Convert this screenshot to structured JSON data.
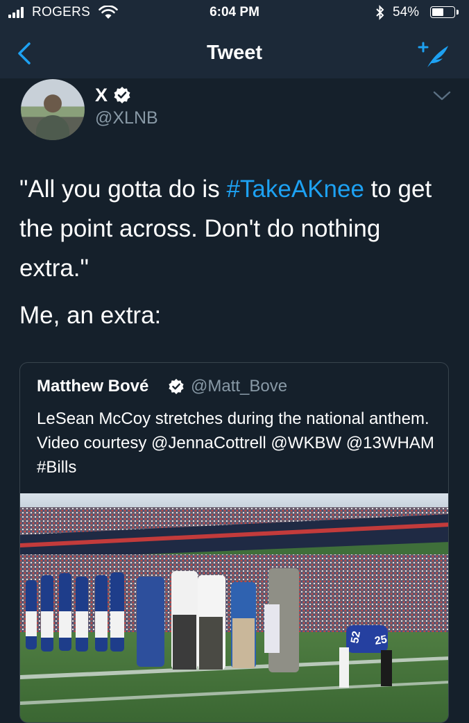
{
  "status_bar": {
    "carrier": "ROGERS",
    "time": "6:04 PM",
    "battery_percent": "54%",
    "battery_level": 0.54,
    "icons": [
      "signal-icon",
      "wifi-icon",
      "bluetooth-icon",
      "battery-icon"
    ]
  },
  "nav": {
    "title": "Tweet",
    "back_icon": "chevron-left-icon",
    "compose_icon": "compose-tweet-icon"
  },
  "tweet": {
    "author_name": "X",
    "author_handle": "@XLNB",
    "text_part1": "\"All you gotta do is ",
    "hashtag": "#TakeAKnee",
    "text_part2": " to get the point across. Don't do nothing extra.\"",
    "text_line2": "Me, an extra:"
  },
  "quoted_tweet": {
    "author_name": "Matthew Bové",
    "author_handle": "@Matt_Bove",
    "text": "LeSean McCoy stretches during the national anthem. Video courtesy @JennaCottrell @WKBW @13WHAM #Bills",
    "media_alt": "stadium-photo"
  },
  "colors": {
    "background": "#15202b",
    "topbar": "#1c2938",
    "accent": "#1da1f2",
    "secondary_text": "#8899a6",
    "border": "#38444d"
  }
}
